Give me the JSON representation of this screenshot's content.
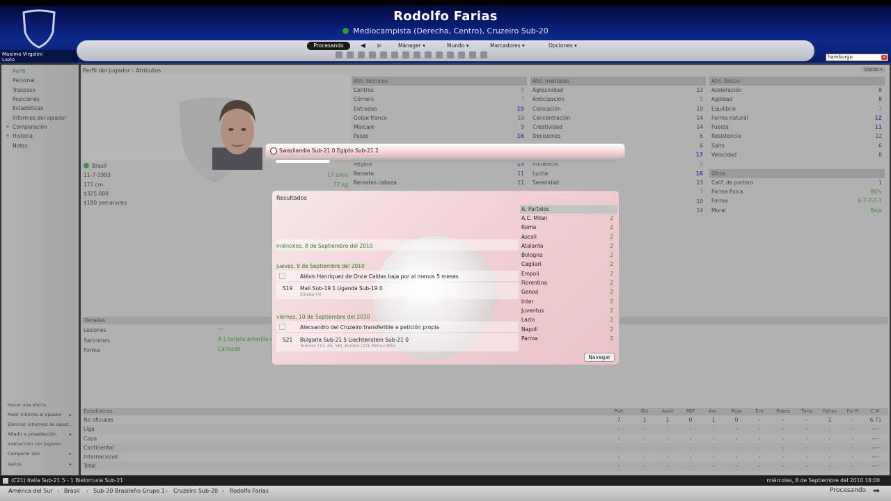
{
  "header": {
    "player_name": "Rodolfo Farias",
    "subtitle": "Mediocampista (Derecha, Centro), Cruzeiro Sub-20",
    "manager_name": "Maximo Virgolini",
    "manager_club": "Lazio"
  },
  "nav": {
    "processing": "Procesando",
    "manager": "Mánager ▾",
    "world": "Mundo ▾",
    "bookmarks": "Marcadores ▾",
    "options": "Opciones ▾",
    "back": "◀",
    "forward": "▶",
    "search_value": "hamburgo",
    "clear": "×"
  },
  "sidebar": {
    "items": [
      {
        "label": "Perfil"
      },
      {
        "label": "Personal"
      },
      {
        "label": "Traspaso"
      },
      {
        "label": "Posiciones"
      },
      {
        "label": "Estadísticas"
      },
      {
        "label": "Informes del ojeador"
      },
      {
        "label": "Comparación"
      },
      {
        "label": "Historia"
      },
      {
        "label": "Notas"
      }
    ],
    "actions": [
      {
        "label": "Hacer una oferta",
        "arrow": ""
      },
      {
        "label": "Pedir informe al ojeador",
        "arrow": "▸"
      },
      {
        "label": "Eliminar informes de ojead...",
        "arrow": ""
      },
      {
        "label": "Añadir a preselección",
        "arrow": "▸"
      },
      {
        "label": "Interacción con jugador",
        "arrow": ""
      },
      {
        "label": "Comparar con",
        "arrow": "▸"
      },
      {
        "label": "Varios",
        "arrow": "▸"
      }
    ]
  },
  "main": {
    "title": "Perfil del jugador - Atributos",
    "views": "Vistas ▾",
    "info": {
      "nationality": "Brasil",
      "dob": "11-7-1993",
      "age": "17 años",
      "height": "177 cm",
      "weight": "77 kg",
      "value": "$325,000",
      "wage": "$180 semanales"
    },
    "technical": {
      "header": "Atri. técnicos",
      "rows": [
        {
          "n": "Centros",
          "v": "5"
        },
        {
          "n": "Córners",
          "v": "7"
        },
        {
          "n": "Entradas",
          "v": "19",
          "s": "blue"
        },
        {
          "n": "Golpe franco",
          "v": "10"
        },
        {
          "n": "Marcaje",
          "v": "9"
        },
        {
          "n": "Pases",
          "v": "16",
          "s": "blue"
        },
        {
          "n": "",
          "v": ""
        },
        {
          "n": "",
          "v": ""
        },
        {
          "n": "Regate",
          "v": "15"
        },
        {
          "n": "Remate",
          "v": "11"
        },
        {
          "n": "Remates cabeza",
          "v": "11"
        }
      ]
    },
    "mental": {
      "header": "Atri. mentales",
      "rows": [
        {
          "n": "Agresividad",
          "v": "13"
        },
        {
          "n": "Anticipación",
          "v": "5"
        },
        {
          "n": "Colocación",
          "v": "10"
        },
        {
          "n": "Concentración",
          "v": "14"
        },
        {
          "n": "Creatividad",
          "v": "14"
        },
        {
          "n": "Decisiones",
          "v": "6"
        },
        {
          "n": "",
          "v": "6"
        },
        {
          "n": "",
          "v": "17",
          "s": "blue"
        },
        {
          "n": "Influencia",
          "v": "5"
        },
        {
          "n": "Lucha",
          "v": "16",
          "s": "blue"
        },
        {
          "n": "Serenidad",
          "v": "13"
        },
        {
          "n": "",
          "v": "3"
        },
        {
          "n": "",
          "v": "10"
        },
        {
          "n": "",
          "v": "14"
        }
      ]
    },
    "physical": {
      "header": "Atri. físicos",
      "rows": [
        {
          "n": "Aceleración",
          "v": "8"
        },
        {
          "n": "Agilidad",
          "v": "8"
        },
        {
          "n": "Equilibrio",
          "v": "3"
        },
        {
          "n": "Forma natural",
          "v": "12",
          "s": "blue"
        },
        {
          "n": "Fuerza",
          "v": "11",
          "s": "blue"
        },
        {
          "n": "Resistencia",
          "v": "12"
        },
        {
          "n": "Salto",
          "v": "6"
        },
        {
          "n": "Velocidad",
          "v": "8"
        }
      ]
    },
    "other": {
      "header": "Otros",
      "rows": [
        {
          "n": "Calif. de portero",
          "v": "1"
        },
        {
          "n": "Forma física",
          "v": "86%",
          "s": "green"
        },
        {
          "n": "Forma",
          "v": "6-7-7-7-7",
          "s": "green"
        },
        {
          "n": "Moral",
          "v": "Baja",
          "s": "green"
        }
      ]
    },
    "details": {
      "header": "Detalles",
      "rows": [
        {
          "n": "Lesiones",
          "v": "---"
        },
        {
          "n": "Sanciones",
          "v": "A 1 tarjeta amarilla d"
        },
        {
          "n": "Forma",
          "v": "Cansado"
        }
      ]
    },
    "stats": {
      "header": "Estadísticas",
      "columns": [
        "Part",
        "Gls",
        "Asist",
        "MJP",
        "Am.",
        "Roja",
        "Ent",
        "Pases",
        "Tiros",
        "Faltas",
        "Fal R",
        "C.M."
      ],
      "rows": [
        {
          "n": "No oficiales",
          "v": [
            "7",
            "1",
            "1",
            "0",
            "1",
            "0",
            "-",
            "-",
            "-",
            "1",
            "-",
            "6.71"
          ]
        },
        {
          "n": "Liga",
          "v": [
            "-",
            "-",
            "-",
            "-",
            "-",
            "-",
            "-",
            "-",
            "-",
            "-",
            "-",
            "----"
          ]
        },
        {
          "n": "Copa",
          "v": [
            "-",
            "-",
            "-",
            "-",
            "-",
            "-",
            "-",
            "-",
            "-",
            "-",
            "-",
            "----"
          ]
        },
        {
          "n": "Continental",
          "v": [
            "-",
            "-",
            "-",
            "-",
            "-",
            "-",
            "-",
            "-",
            "-",
            "-",
            "-",
            "----"
          ]
        },
        {
          "n": "Internacional",
          "v": [
            "-",
            "-",
            "-",
            "-",
            "-",
            "-",
            "-",
            "-",
            "-",
            "-",
            "-",
            "----"
          ]
        },
        {
          "n": "Total",
          "v": [
            "-",
            "-",
            "-",
            "-",
            "-",
            "-",
            "-",
            "-",
            "-",
            "-",
            "-",
            "----"
          ]
        }
      ]
    }
  },
  "toast": {
    "text": "Swazilandia Sub-21 0 Egipto Sub-21 2",
    "progress": 0.16
  },
  "results": {
    "title": "Resultados",
    "days": [
      "miércoles, 8 de Septiembre del 2010",
      "jueves, 9 de Septiembre del 2010",
      "viernes, 10 de Septiembre del 2010"
    ],
    "events": [
      "Aléxis Henríquez de Once Caldas baja por al menos 5 meses",
      "Alecsandro del Cruzeiro transferible a petición propia"
    ],
    "matches": [
      {
        "code": "S19",
        "text": "Mali Sub-19 1 Uganda Sub-19 0",
        "scorers": "Sinaba (4)"
      },
      {
        "code": "S21",
        "text": "Bulgaria Sub-21 5 Liechtenstein Sub-21 0",
        "scorers": "Todorov (13, 46, 58), Kurdov (22), Petrov (65)"
      }
    ],
    "standings_header": "A: Partidos",
    "standings": [
      {
        "t": "A.C. Milan",
        "v": "2"
      },
      {
        "t": "Roma",
        "v": "2"
      },
      {
        "t": "Ascoli",
        "v": "2"
      },
      {
        "t": "Atalanta",
        "v": "2"
      },
      {
        "t": "Bologna",
        "v": "2"
      },
      {
        "t": "Cagliari",
        "v": "2"
      },
      {
        "t": "Empoli",
        "v": "2"
      },
      {
        "t": "Fiorentina",
        "v": "2"
      },
      {
        "t": "Genoa",
        "v": "2"
      },
      {
        "t": "Inter",
        "v": "2"
      },
      {
        "t": "Juventus",
        "v": "2"
      },
      {
        "t": "Lazio",
        "v": "2"
      },
      {
        "t": "Napoli",
        "v": "2"
      },
      {
        "t": "Parma",
        "v": "2"
      }
    ],
    "navigate": "Navegar"
  },
  "statusbar": {
    "left": "(C21) Italia Sub-21 5 - 1 Bielorrusia Sub-21",
    "right": "miércoles, 8 de Septiembre del 2010 18:00"
  },
  "breadcrumbs": {
    "items": [
      "América del Sur",
      "Brasil",
      "Sub-20 Brasileño Grupo 1",
      "Cruzeiro Sub-20",
      "Rodolfo Farias"
    ],
    "processing": "Procesando"
  },
  "colors": {
    "header_blue": "#0d2a8c",
    "value_green": "#2b8a19",
    "value_blue": "#1c2ec3",
    "toast_pink": "#f4d4d8"
  }
}
